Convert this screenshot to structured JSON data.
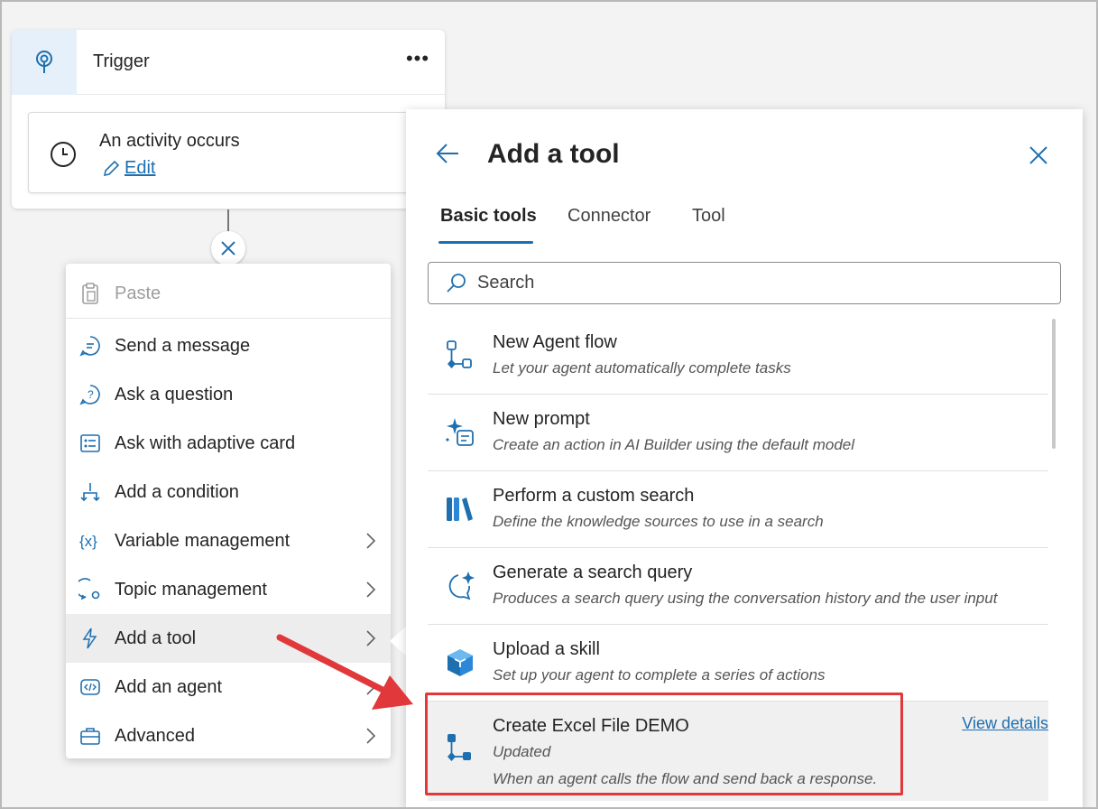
{
  "trigger": {
    "title": "Trigger",
    "more": "•••",
    "activity_title": "An activity occurs",
    "edit_label": "Edit"
  },
  "menu": {
    "items": [
      {
        "label": "Paste",
        "icon": "clipboard-icon",
        "disabled": true
      },
      {
        "label": "Send a message",
        "icon": "chat-icon"
      },
      {
        "label": "Ask a question",
        "icon": "question-bubble-icon"
      },
      {
        "label": "Ask with adaptive card",
        "icon": "adaptive-card-icon"
      },
      {
        "label": "Add a condition",
        "icon": "branch-icon"
      },
      {
        "label": "Variable management",
        "icon": "variable-icon",
        "submenu": true
      },
      {
        "label": "Topic management",
        "icon": "topic-icon",
        "submenu": true
      },
      {
        "label": "Add a tool",
        "icon": "lightning-icon",
        "submenu": true,
        "active": true
      },
      {
        "label": "Add an agent",
        "icon": "agent-icon",
        "submenu": true
      },
      {
        "label": "Advanced",
        "icon": "toolbox-icon",
        "submenu": true
      }
    ]
  },
  "panel": {
    "title": "Add a tool",
    "tabs": [
      "Basic tools",
      "Connector",
      "Tool"
    ],
    "selected_tab": "Basic tools",
    "search_placeholder": "Search",
    "tools": [
      {
        "name": "New Agent flow",
        "description": "Let your agent automatically complete tasks",
        "icon": "flow-icon"
      },
      {
        "name": "New prompt",
        "description": "Create an action in AI Builder using the default model",
        "icon": "prompt-sparkle-icon"
      },
      {
        "name": "Perform a custom search",
        "description": "Define the knowledge sources to use in a search",
        "icon": "books-icon"
      },
      {
        "name": "Generate a search query",
        "description": "Produces a search query using the conversation history and the user input",
        "icon": "sparkle-chat-icon"
      },
      {
        "name": "Upload a skill",
        "description": "Set up your agent to complete a series of actions",
        "icon": "cube-icon"
      },
      {
        "name": "Create Excel File DEMO",
        "status": "Updated",
        "description": "When an agent calls the flow and send back a response.",
        "icon": "flow-icon",
        "link": "View details"
      }
    ]
  },
  "colors": {
    "accent": "#1e6fb0",
    "highlight_border": "#e0383b",
    "arrow": "#e0383b"
  }
}
